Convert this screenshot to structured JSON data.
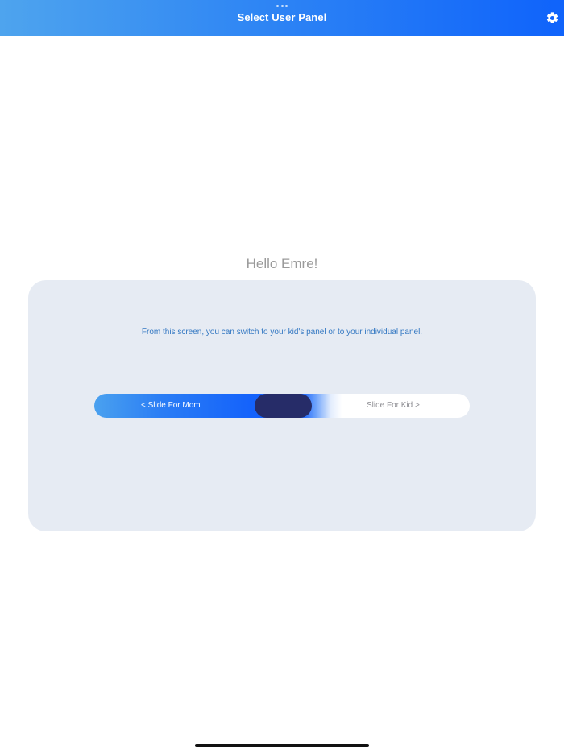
{
  "header": {
    "title": "Select User Panel",
    "settings_icon": "gear-icon",
    "gradient_colors": [
      "#4ea4ee",
      "#0f63fb"
    ]
  },
  "greeting": "Hello Emre!",
  "panel": {
    "description": "From this screen, you can switch to your kid's panel or to your individual panel.",
    "slider": {
      "left_label": "< Slide For Mom",
      "right_label": "Slide For Kid >",
      "handle_color": "#262c68",
      "handle_position": 0.5
    }
  },
  "colors": {
    "card_background": "#e6ebf3",
    "description_text": "#3277c2",
    "greeting_text": "#9a9a9a"
  }
}
